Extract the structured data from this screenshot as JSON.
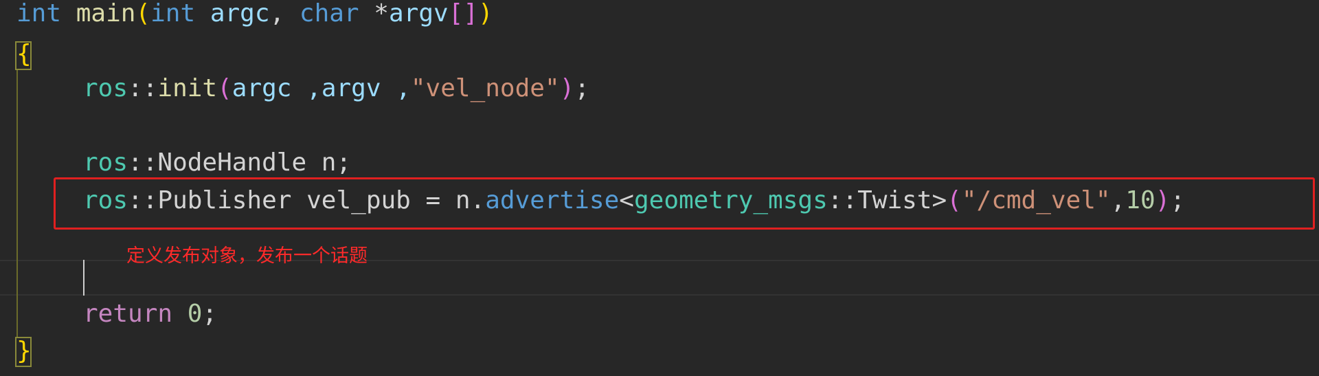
{
  "code": {
    "line1": {
      "kw_int": "int",
      "fn_main": "main",
      "open_paren": "(",
      "kw_int2": "int",
      "argc": "argc",
      "comma": ",",
      "kw_char": "char",
      "star": "*",
      "argv": "argv",
      "brackets": "[]",
      "close_paren": ")"
    },
    "open_brace": "{",
    "line3": {
      "ns": "ros",
      "sep": "::",
      "fn": "init",
      "open_paren": "(",
      "args": "argc ,argv ,",
      "str": "\"vel_node\"",
      "close_paren": ")",
      "semi": ";"
    },
    "line5": {
      "ns": "ros",
      "sep": "::",
      "type": "NodeHandle n;"
    },
    "line6": {
      "ns": "ros",
      "sep": "::",
      "type": "Publisher vel_pub = n.",
      "method": "advertise",
      "lt": "<",
      "ns2": "geometry_msgs",
      "sep2": "::",
      "type2": "Twist>",
      "open_paren": "(",
      "str": "\"/cmd_vel\"",
      "comma": ",",
      "num": "10",
      "close_paren": ")",
      "semi": ";"
    },
    "line9": {
      "ret": "return",
      "num": "0",
      "semi": ";"
    },
    "close_brace": "}"
  },
  "annotation": "定义发布对象，发布一个话题",
  "colors": {
    "background": "#272727",
    "keyword": "#569cd6",
    "function": "#dcdcaa",
    "namespace": "#4ec9b0",
    "string": "#ce9178",
    "number": "#b5cea8",
    "return_keyword": "#c586c0",
    "annotation": "#ff2a2a",
    "highlight_box": "#e02020"
  }
}
